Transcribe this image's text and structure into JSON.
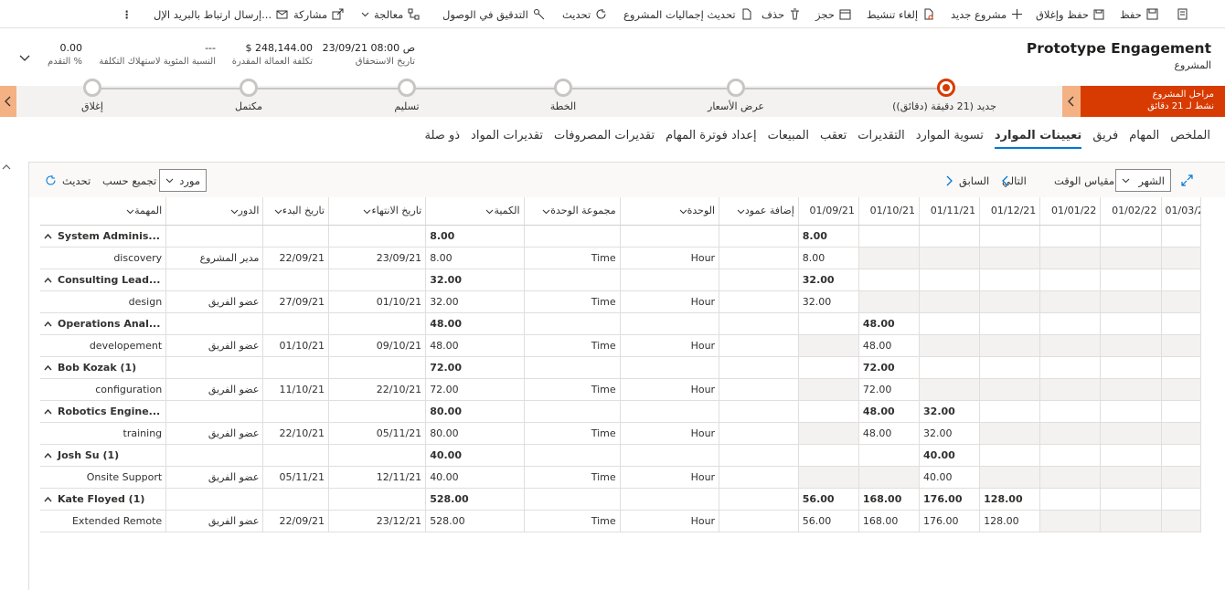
{
  "commands": {
    "save": "حفظ",
    "save_close": "حفظ وإغلاق",
    "new_project": "مشروع جديد",
    "deactivate": "إلغاء تنشيط",
    "book": "حجز",
    "delete": "حذف",
    "update_totals": "تحديث إجماليات المشروع",
    "refresh": "تحديث",
    "check_access": "التدقيق في الوصول",
    "process": "معالجة",
    "share": "مشاركة",
    "email_link": "إرسال ارتباط بالبريد الإل...",
    "more": "⋮"
  },
  "header": {
    "title": "Prototype Engagement",
    "entity": "المشروع",
    "due_date_value": "23/09/21 08:00 ص",
    "due_date_label": "تاريخ الاستحقاق",
    "estimated_cost_value": "$ 248,144.00",
    "estimated_cost_label": "تكلفة العمالة المقدرة",
    "cost_consumption_value": "---",
    "cost_consumption_label": "النسبة المئوية لاستهلاك التكلفة",
    "progress_value": "0.00",
    "progress_label": "التقدم %"
  },
  "bpf": {
    "active_title": "مراحل المشروع",
    "active_sub": "نشط لـ 21 دقائق",
    "stages": [
      {
        "label": "جديد  (21 دقيقة (دقائق))"
      },
      {
        "label": "عرض الأسعار"
      },
      {
        "label": "الخطة"
      },
      {
        "label": "تسليم"
      },
      {
        "label": "مكتمل"
      },
      {
        "label": "إغلاق"
      }
    ]
  },
  "tabs": [
    "الملخص",
    "المهام",
    "فريق",
    "تعيينات الموارد",
    "تسوية الموارد",
    "التقديرات",
    "تعقب",
    "المبيعات",
    "إعداد فوترة المهام",
    "تقديرات المصروفات",
    "تقديرات المواد",
    "ذو صلة"
  ],
  "grid_toolbar": {
    "timescale_value": "الشهر",
    "timescale_label": "مقياس الوقت",
    "next": "التالي",
    "previous": "السابق",
    "group_value": "مورد",
    "group_label": "تجميع حسب",
    "refresh": "تحديث"
  },
  "columns": {
    "task": "المهمة",
    "role": "الدور",
    "start": "تاريخ البدء",
    "end": "تاريخ الانتهاء",
    "quantity": "الكمية",
    "unit_group": "مجموعة الوحدة",
    "unit": "الوحدة",
    "add_column": "إضافة عمود",
    "months": [
      "01/09/21",
      "01/10/21",
      "01/11/21",
      "01/12/21",
      "01/01/22",
      "01/02/22",
      "01/03/2"
    ]
  },
  "groups": [
    {
      "name": "System Adminis...",
      "qty": "8.00",
      "months": [
        "8.00",
        "",
        "",
        "",
        "",
        "",
        ""
      ],
      "row": {
        "task": "discovery",
        "role": "مدير المشروع",
        "start": "22/09/21",
        "end": "23/09/21",
        "qty": "8.00",
        "unit_group": "Time",
        "unit": "Hour",
        "months": [
          "8.00",
          "",
          "",
          "",
          "",
          "",
          ""
        ]
      }
    },
    {
      "name": "Consulting Lead...",
      "qty": "32.00",
      "months": [
        "32.00",
        "",
        "",
        "",
        "",
        "",
        ""
      ],
      "row": {
        "task": "design",
        "role": "عضو الفريق",
        "start": "27/09/21",
        "end": "01/10/21",
        "qty": "32.00",
        "unit_group": "Time",
        "unit": "Hour",
        "months": [
          "32.00",
          "",
          "",
          "",
          "",
          "",
          ""
        ]
      }
    },
    {
      "name": "Operations Anal...",
      "qty": "48.00",
      "months": [
        "",
        "48.00",
        "",
        "",
        "",
        "",
        ""
      ],
      "row": {
        "task": "developement",
        "role": "عضو الفريق",
        "start": "01/10/21",
        "end": "09/10/21",
        "qty": "48.00",
        "unit_group": "Time",
        "unit": "Hour",
        "months": [
          "",
          "48.00",
          "",
          "",
          "",
          "",
          ""
        ]
      }
    },
    {
      "name": "Bob Kozak (1)",
      "qty": "72.00",
      "months": [
        "",
        "72.00",
        "",
        "",
        "",
        "",
        ""
      ],
      "row": {
        "task": "configuration",
        "role": "عضو الفريق",
        "start": "11/10/21",
        "end": "22/10/21",
        "qty": "72.00",
        "unit_group": "Time",
        "unit": "Hour",
        "months": [
          "",
          "72.00",
          "",
          "",
          "",
          "",
          ""
        ]
      }
    },
    {
      "name": "Robotics Engine...",
      "qty": "80.00",
      "months": [
        "",
        "48.00",
        "32.00",
        "",
        "",
        "",
        ""
      ],
      "row": {
        "task": "training",
        "role": "عضو الفريق",
        "start": "22/10/21",
        "end": "05/11/21",
        "qty": "80.00",
        "unit_group": "Time",
        "unit": "Hour",
        "months": [
          "",
          "48.00",
          "32.00",
          "",
          "",
          "",
          ""
        ]
      }
    },
    {
      "name": "Josh Su (1)",
      "qty": "40.00",
      "months": [
        "",
        "",
        "40.00",
        "",
        "",
        "",
        ""
      ],
      "row": {
        "task": "Onsite Support",
        "role": "عضو الفريق",
        "start": "05/11/21",
        "end": "12/11/21",
        "qty": "40.00",
        "unit_group": "Time",
        "unit": "Hour",
        "months": [
          "",
          "",
          "40.00",
          "",
          "",
          "",
          ""
        ]
      }
    },
    {
      "name": "Kate Floyed (1)",
      "qty": "528.00",
      "months": [
        "56.00",
        "168.00",
        "176.00",
        "128.00",
        "",
        "",
        ""
      ],
      "row": {
        "task": "Extended Remote",
        "role": "عضو الفريق",
        "start": "22/09/21",
        "end": "23/12/21",
        "qty": "528.00",
        "unit_group": "Time",
        "unit": "Hour",
        "months": [
          "56.00",
          "168.00",
          "176.00",
          "128.00",
          "",
          "",
          ""
        ]
      }
    }
  ]
}
